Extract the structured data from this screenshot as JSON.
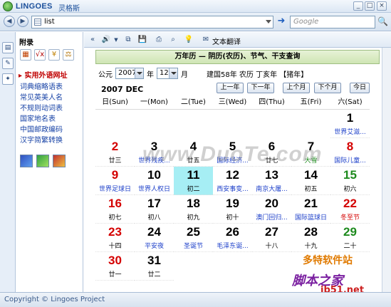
{
  "window": {
    "brand": "LINGOES",
    "brand_cn": "灵格斯",
    "controls": [
      "_",
      "□",
      "×"
    ]
  },
  "addressbar": {
    "value": "list",
    "search_placeholder": "Google"
  },
  "sidebar": {
    "title": "附录",
    "active_link": "实用外语网址",
    "links": [
      "词典缩略语表",
      "常见英美人名",
      "不规则动词表",
      "国家地名表",
      "中国邮政编码",
      "汉字简繁转换"
    ]
  },
  "toolbar": {
    "translate_label": "文本翻译"
  },
  "calendar": {
    "header": "万年历 — 阴历(农历)、节气、干支查询",
    "year_prefix": "公元",
    "year": "2007",
    "year_suffix": "年",
    "month": "12",
    "month_suffix": "月",
    "lunar_info": "建国58年  农历 丁亥年  【猪年】",
    "month_title": "2007 DEC",
    "nav": [
      "上一年",
      "下一年",
      "上个月",
      "下个月",
      "今日"
    ],
    "weekdays": [
      "日(Sun)",
      "一(Mon)",
      "二(Tue)",
      "三(Wed)",
      "四(Thu)",
      "五(Fri)",
      "六(Sat)"
    ],
    "days": [
      {
        "d": "1",
        "sub": "世界艾滋...",
        "col": 6,
        "row": 0,
        "sub_color": "blue"
      },
      {
        "d": "2",
        "sub": "廿三",
        "col": 0,
        "row": 1,
        "num_color": "red"
      },
      {
        "d": "3",
        "sub": "世界残疾...",
        "col": 1,
        "row": 1,
        "sub_color": "blue"
      },
      {
        "d": "4",
        "sub": "廿五",
        "col": 2,
        "row": 1
      },
      {
        "d": "5",
        "sub": "国际经济...",
        "col": 3,
        "row": 1,
        "sub_color": "blue"
      },
      {
        "d": "6",
        "sub": "廿七",
        "col": 4,
        "row": 1
      },
      {
        "d": "7",
        "sub": "大雪",
        "col": 5,
        "row": 1,
        "sub_color": "green"
      },
      {
        "d": "8",
        "sub": "国际儿童...",
        "col": 6,
        "row": 1,
        "num_color": "red",
        "sub_color": "blue"
      },
      {
        "d": "9",
        "sub": "世界足球日",
        "col": 0,
        "row": 2,
        "num_color": "red",
        "sub_color": "blue"
      },
      {
        "d": "10",
        "sub": "世界人权日",
        "col": 1,
        "row": 2,
        "sub_color": "blue"
      },
      {
        "d": "11",
        "sub": "初二",
        "col": 2,
        "row": 2,
        "today": true
      },
      {
        "d": "12",
        "sub": "西安事变...",
        "col": 3,
        "row": 2,
        "sub_color": "blue"
      },
      {
        "d": "13",
        "sub": "南京大屠...",
        "col": 4,
        "row": 2,
        "sub_color": "blue"
      },
      {
        "d": "14",
        "sub": "初五",
        "col": 5,
        "row": 2
      },
      {
        "d": "15",
        "sub": "初六",
        "col": 6,
        "row": 2,
        "num_color": "green"
      },
      {
        "d": "16",
        "sub": "初七",
        "col": 0,
        "row": 3,
        "num_color": "red"
      },
      {
        "d": "17",
        "sub": "初八",
        "col": 1,
        "row": 3
      },
      {
        "d": "18",
        "sub": "初九",
        "col": 2,
        "row": 3
      },
      {
        "d": "19",
        "sub": "初十",
        "col": 3,
        "row": 3
      },
      {
        "d": "20",
        "sub": "澳门回归...",
        "col": 4,
        "row": 3,
        "sub_color": "blue"
      },
      {
        "d": "21",
        "sub": "国际篮球日",
        "col": 5,
        "row": 3,
        "sub_color": "blue"
      },
      {
        "d": "22",
        "sub": "冬至节",
        "col": 6,
        "row": 3,
        "num_color": "red",
        "sub_color": "red"
      },
      {
        "d": "23",
        "sub": "十四",
        "col": 0,
        "row": 4,
        "num_color": "red"
      },
      {
        "d": "24",
        "sub": "平安夜",
        "col": 1,
        "row": 4,
        "sub_color": "blue"
      },
      {
        "d": "25",
        "sub": "圣诞节",
        "col": 2,
        "row": 4,
        "sub_color": "blue"
      },
      {
        "d": "26",
        "sub": "毛泽东诞...",
        "col": 3,
        "row": 4,
        "sub_color": "blue"
      },
      {
        "d": "27",
        "sub": "十八",
        "col": 4,
        "row": 4
      },
      {
        "d": "28",
        "sub": "十九",
        "col": 5,
        "row": 4
      },
      {
        "d": "29",
        "sub": "二十",
        "col": 6,
        "row": 4,
        "num_color": "green"
      },
      {
        "d": "30",
        "sub": "廿一",
        "col": 0,
        "row": 5,
        "num_color": "red"
      },
      {
        "d": "31",
        "sub": "廿二",
        "col": 1,
        "row": 5
      }
    ]
  },
  "watermark": {
    "text": "www.DuoTe.com",
    "brand1": "多特软件站",
    "brand2": "脚本之家",
    "brand3": "jb51.net"
  },
  "status": {
    "text": "Copyright © Lingoes Project"
  },
  "colors": {
    "today_bg": "#a6eef4",
    "red": "#d40000",
    "green": "#1d8a1d",
    "blue": "#1b3ec9"
  }
}
